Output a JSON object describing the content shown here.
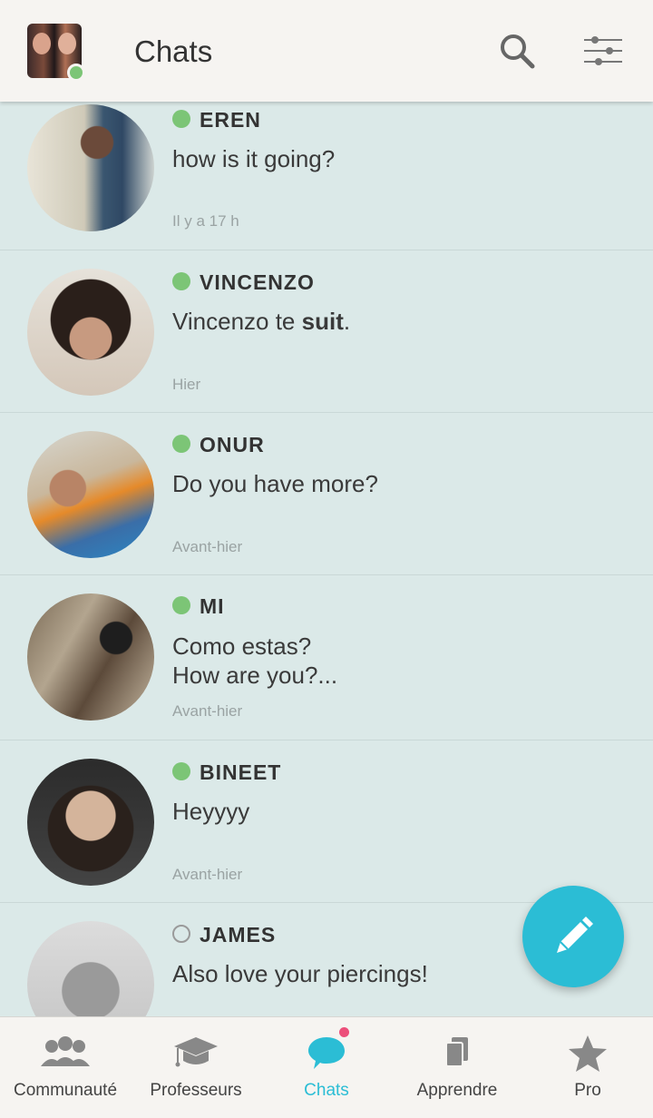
{
  "header": {
    "title": "Chats",
    "search_icon": "search-icon",
    "filters_icon": "sliders-icon"
  },
  "colors": {
    "accent": "#2bbdd5",
    "online": "#7cc576",
    "badge": "#ec4f7a",
    "list_bg": "#dbe9e8"
  },
  "chats": [
    {
      "name": "EREN",
      "online": true,
      "message": "how is it going?",
      "time": "Il y a 17 h"
    },
    {
      "name": "VINCENZO",
      "online": true,
      "message_prefix": "Vincenzo te ",
      "message_bold": "suit",
      "message_suffix": ".",
      "time": "Hier"
    },
    {
      "name": "ONUR",
      "online": true,
      "message": "Do you have more?",
      "time": "Avant-hier"
    },
    {
      "name": "MI",
      "online": true,
      "message_line1": "Como estas?",
      "message_line2": "How are you?...",
      "time": "Avant-hier"
    },
    {
      "name": "BINEET",
      "online": true,
      "message": "Heyyyy",
      "time": "Avant-hier"
    },
    {
      "name": "JAMES",
      "online": false,
      "message": "Also love your piercings!"
    }
  ],
  "fab": {
    "icon": "pencil-icon"
  },
  "nav": [
    {
      "label": "Communauté",
      "icon": "community-icon",
      "active": false
    },
    {
      "label": "Professeurs",
      "icon": "graduation-cap-icon",
      "active": false
    },
    {
      "label": "Chats",
      "icon": "chat-bubble-icon",
      "active": true
    },
    {
      "label": "Apprendre",
      "icon": "cards-icon",
      "active": false
    },
    {
      "label": "Pro",
      "icon": "star-icon",
      "active": false
    }
  ]
}
